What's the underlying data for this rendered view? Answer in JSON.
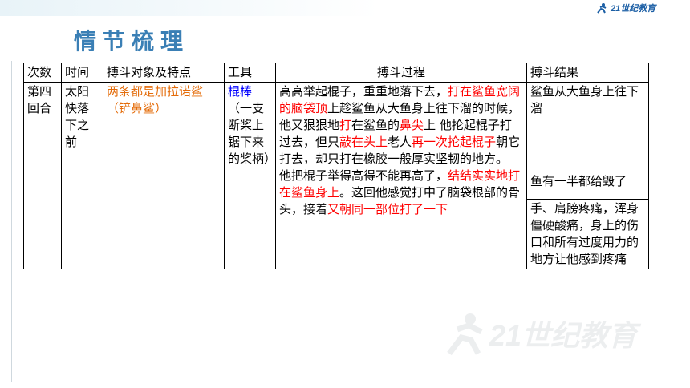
{
  "logo": {
    "text": "21世纪教育"
  },
  "title": "情节梳理",
  "table": {
    "headers": [
      "次数",
      "时间",
      "搏斗对象及特点",
      "工具",
      "搏斗过程",
      "搏斗结果"
    ],
    "row": {
      "count": "第四回合",
      "time": "太阳快落下之前",
      "target": "两条都是加拉诺鲨（铲鼻鲨）",
      "tool_main": "棍棒",
      "tool_note": "（一支断桨上锯下来的桨柄）",
      "process": [
        {
          "t": "高高举起棍子，重重地落下去，",
          "c": "black"
        },
        {
          "t": "打在鲨鱼宽阔的脑袋顶",
          "c": "red"
        },
        {
          "t": "上趁鲨鱼从大鱼身上往下溜的时候，他又狠狠地",
          "c": "black"
        },
        {
          "t": "打",
          "c": "red"
        },
        {
          "t": "在鲨鱼的",
          "c": "black"
        },
        {
          "t": "鼻尖",
          "c": "red"
        },
        {
          "t": "上 他抡起棍子打过去，但只",
          "c": "black"
        },
        {
          "t": "敲在头上",
          "c": "red"
        },
        {
          "t": "老人",
          "c": "black"
        },
        {
          "t": "再一次抡起棍子",
          "c": "red"
        },
        {
          "t": "朝它打去，却只打在橡胶一般厚实坚韧的地方。 他把棍子举得高得不能再高了，",
          "c": "black"
        },
        {
          "t": "结结实实地打在鲨鱼身上",
          "c": "red"
        },
        {
          "t": "。这回他感觉打中了脑袋根部的骨头，接着",
          "c": "black"
        },
        {
          "t": "又朝同一部位打了一下",
          "c": "red"
        }
      ],
      "results": [
        "鲨鱼从大鱼身上往下溜",
        "鱼有一半都给毁了",
        "手、肩膀疼痛，浑身僵硬酸痛，身上的伤口和所有过度用力的地方让他感到疼痛"
      ]
    }
  },
  "colors": {
    "title": "#3a7fb5",
    "orange": "#e46c0a",
    "blue": "#0000ff",
    "red": "#ff0000"
  }
}
